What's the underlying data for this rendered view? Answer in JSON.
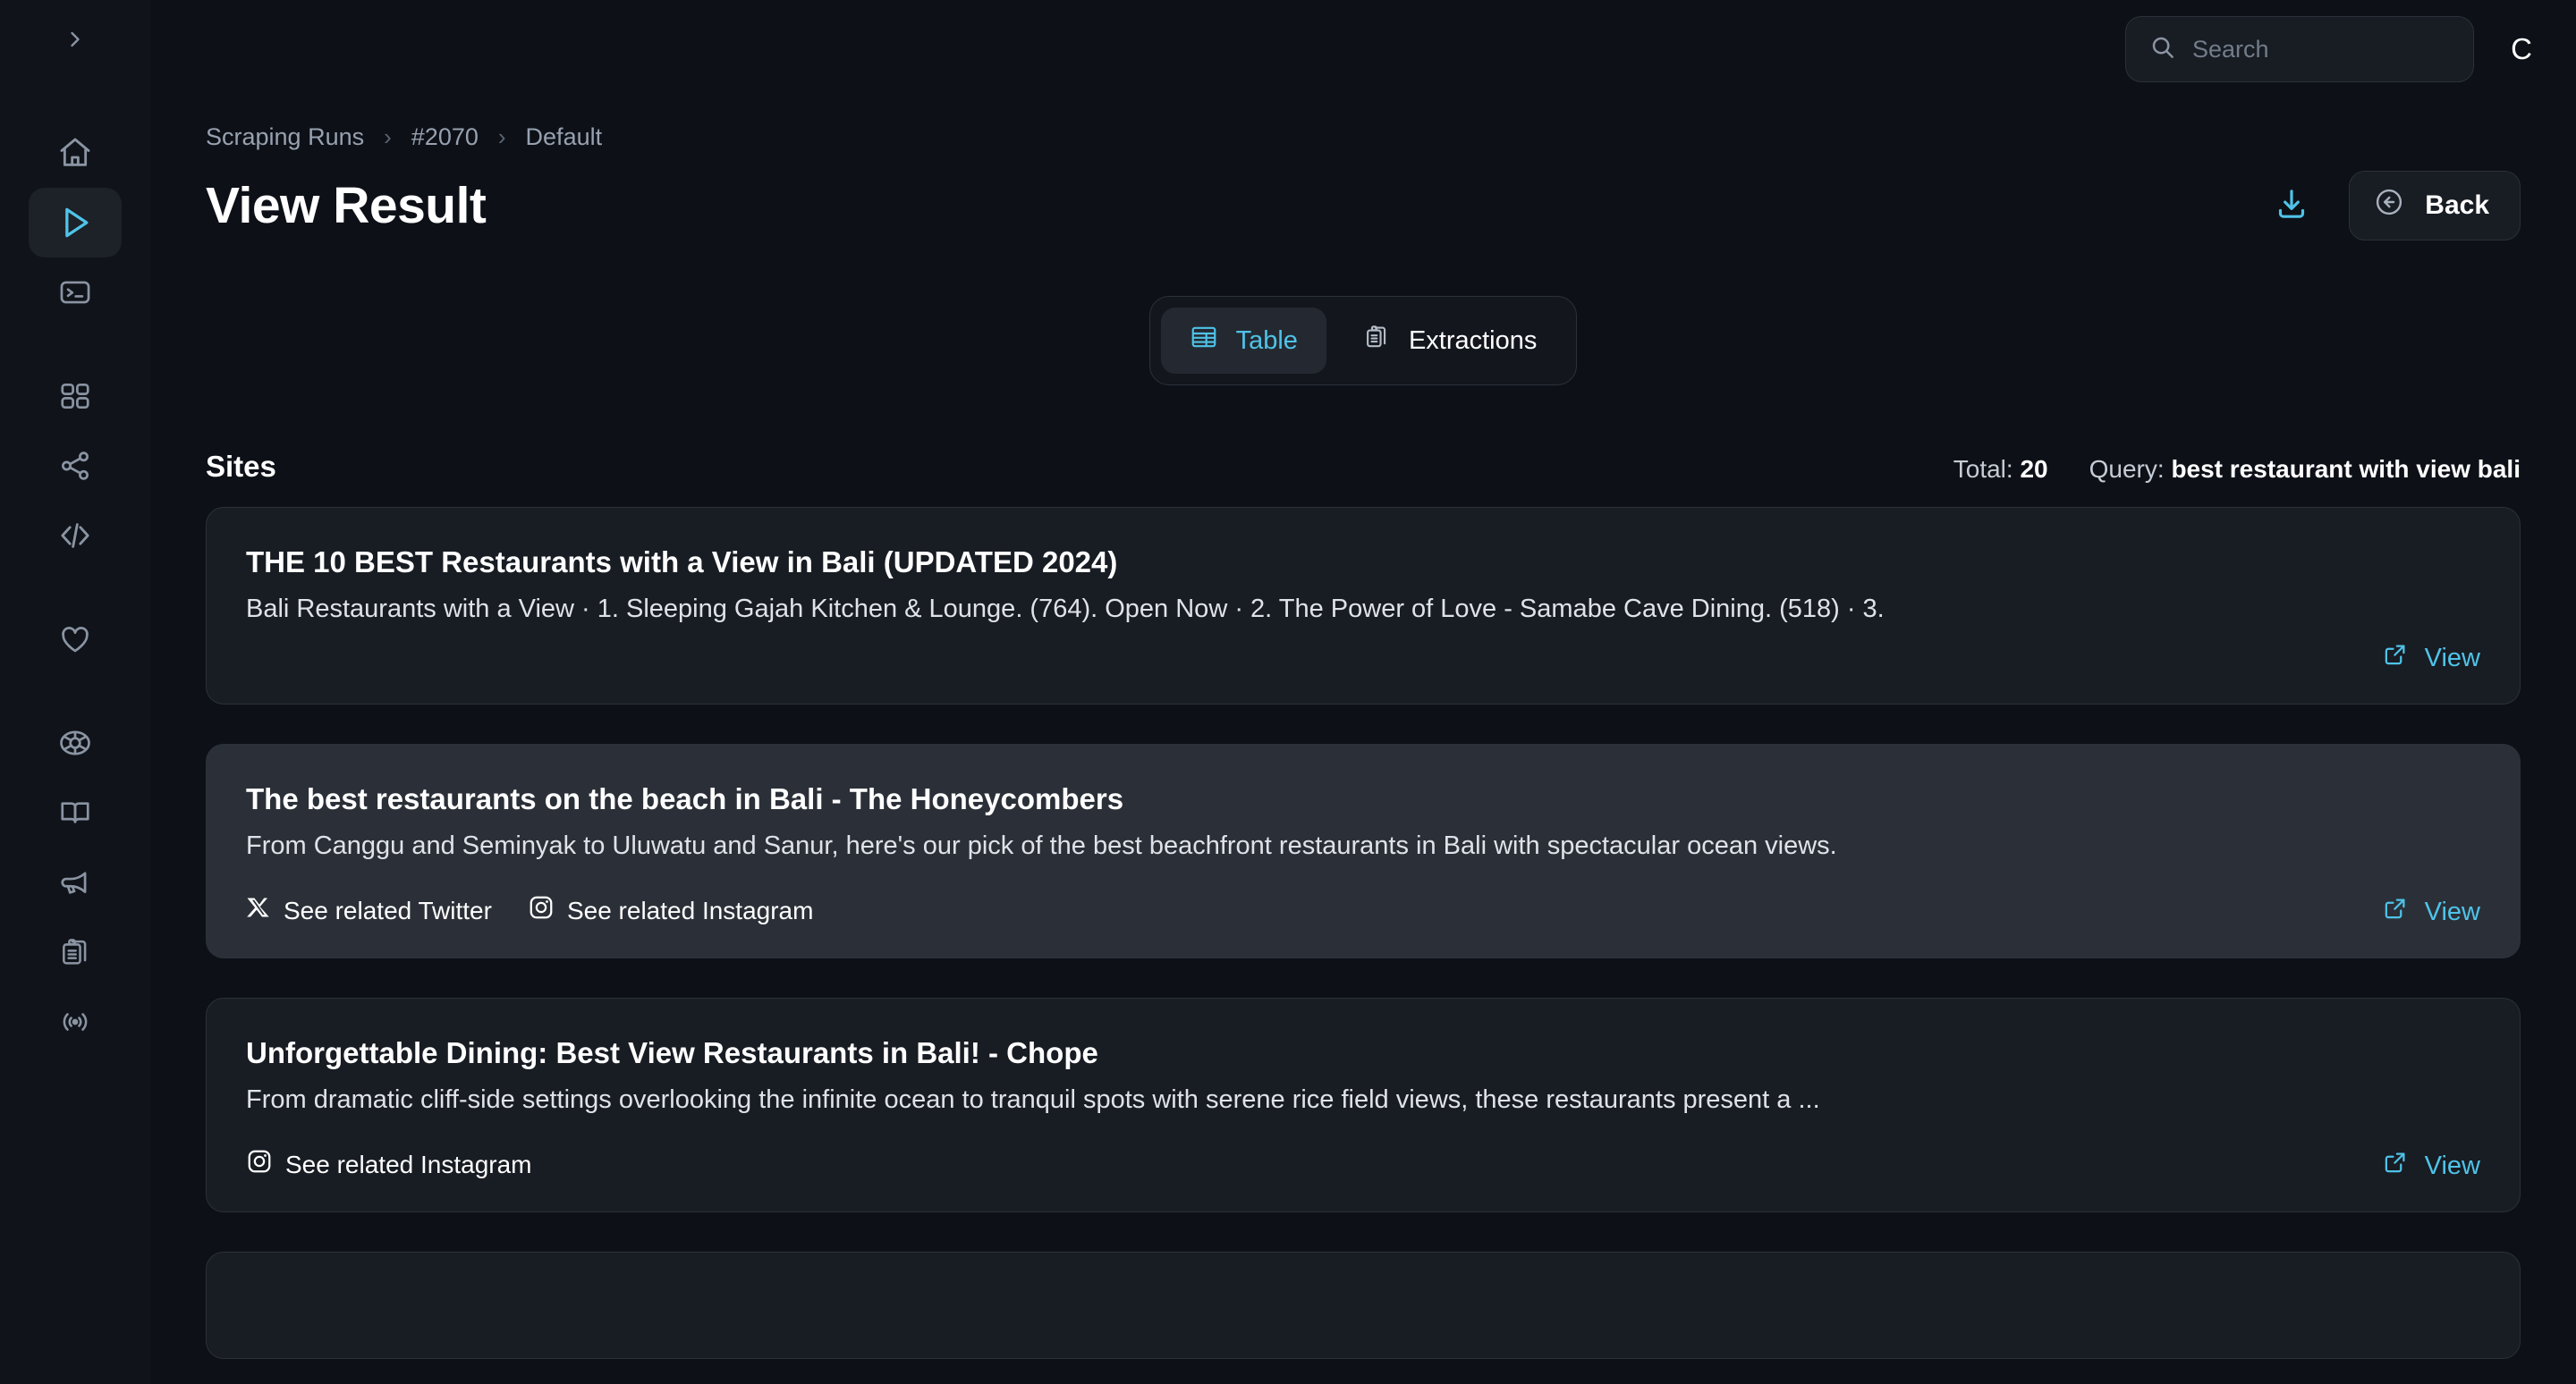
{
  "sidebar": {
    "toggle_icon": "chevron-right-icon",
    "items": [
      {
        "icon": "home-icon",
        "name": "home",
        "active": false
      },
      {
        "icon": "play-icon",
        "name": "scraping-runs",
        "active": true
      },
      {
        "icon": "terminal-icon",
        "name": "terminal",
        "active": false
      },
      {
        "icon": "grid-icon",
        "name": "apps",
        "active": false
      },
      {
        "icon": "share-icon",
        "name": "integrations",
        "active": false
      },
      {
        "icon": "code-icon",
        "name": "api",
        "active": false
      },
      {
        "icon": "heart-icon",
        "name": "favorites",
        "active": false
      },
      {
        "icon": "lifebuoy-icon",
        "name": "support",
        "active": false
      },
      {
        "icon": "book-icon",
        "name": "docs",
        "active": false
      },
      {
        "icon": "megaphone-icon",
        "name": "announcements",
        "active": false
      },
      {
        "icon": "clipboard-icon",
        "name": "tasks",
        "active": false
      },
      {
        "icon": "broadcast-icon",
        "name": "live",
        "active": false
      }
    ]
  },
  "topbar": {
    "search_placeholder": "Search",
    "search_value": "",
    "avatar_letter": "C"
  },
  "breadcrumb": [
    {
      "label": "Scraping Runs"
    },
    {
      "label": "#2070"
    },
    {
      "label": "Default"
    }
  ],
  "breadcrumb_separator": "›",
  "header": {
    "title": "View Result",
    "download_icon": "download-icon",
    "back_label": "Back",
    "back_icon": "arrow-left-circle-icon"
  },
  "tabs": [
    {
      "label": "Table",
      "icon": "table-icon",
      "active": true
    },
    {
      "label": "Extractions",
      "icon": "clipboard-list-icon",
      "active": false
    }
  ],
  "sites": {
    "label": "Sites",
    "total_label": "Total:",
    "total_value": "20",
    "query_label": "Query:",
    "query_value": "best restaurant with view bali"
  },
  "view_link_label": "View",
  "view_link_icon": "external-link-icon",
  "results": [
    {
      "title": "THE 10 BEST Restaurants with a View in Bali (UPDATED 2024)",
      "description": "Bali Restaurants with a View · 1. Sleeping Gajah Kitchen & Lounge. (764). Open Now · 2. The Power of Love - Samabe Cave Dining. (518) · 3.",
      "socials": [],
      "hovered": false
    },
    {
      "title": "The best restaurants on the beach in Bali - The Honeycombers",
      "description": "From Canggu and Seminyak to Uluwatu and Sanur, here's our pick of the best beachfront restaurants in Bali with spectacular ocean views.",
      "socials": [
        {
          "icon": "x-twitter-icon",
          "label": "See related Twitter"
        },
        {
          "icon": "instagram-icon",
          "label": "See related Instagram"
        }
      ],
      "hovered": true
    },
    {
      "title": "Unforgettable Dining: Best View Restaurants in Bali! - Chope",
      "description": "From dramatic cliff-side settings overlooking the infinite ocean to tranquil spots with serene rice field views, these restaurants present a ...",
      "socials": [
        {
          "icon": "instagram-icon",
          "label": "See related Instagram"
        }
      ],
      "hovered": false
    },
    {
      "title": "",
      "description": "",
      "socials": [],
      "hovered": false
    }
  ],
  "colors": {
    "accent": "#4fc3e8",
    "page_bg": "#0d1117",
    "sidebar_bg": "#10141a",
    "card_bg": "#181c23",
    "card_hover_bg": "#2b3038",
    "border": "#2b313a"
  }
}
